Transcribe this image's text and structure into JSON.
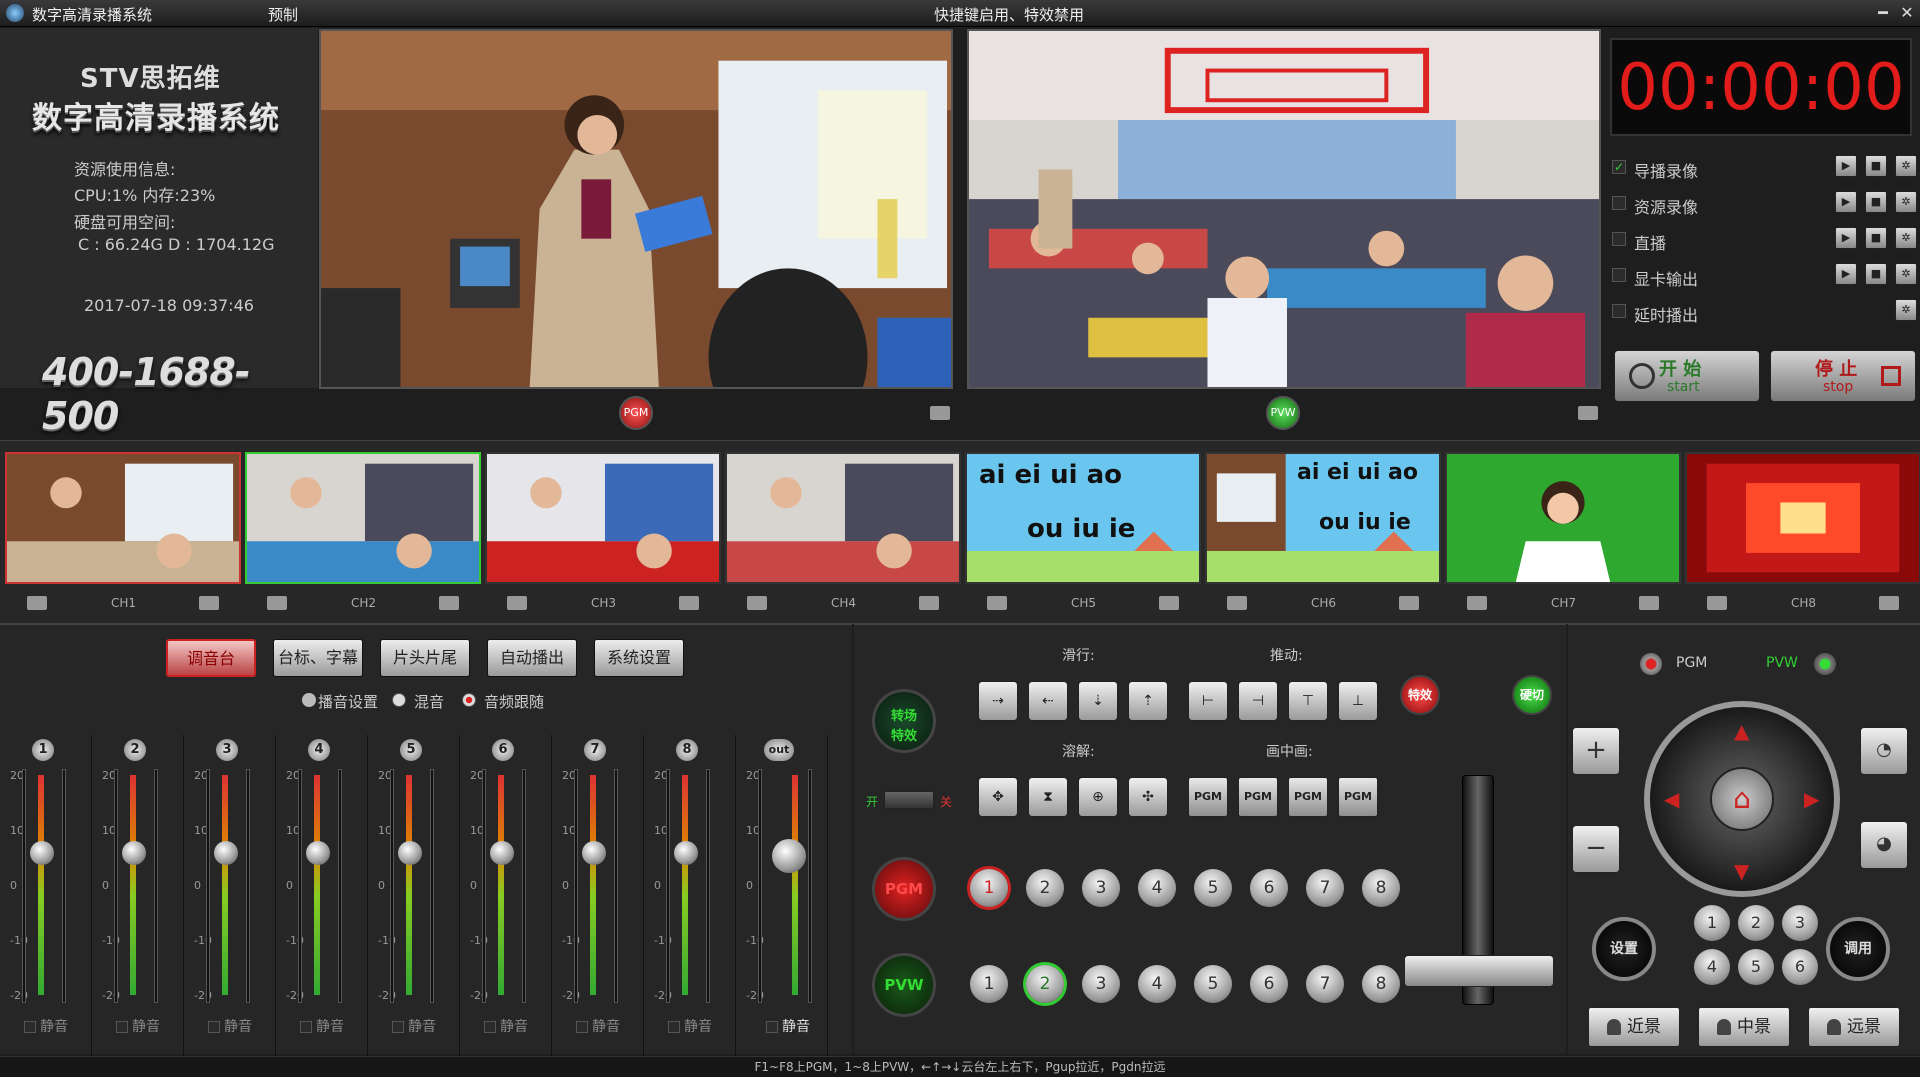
{
  "titlebar": {
    "app_title": "数字高清录播系统",
    "menu": "预制",
    "center_notice": "快捷键启用、特效禁用",
    "minimize": "━",
    "close": "✕"
  },
  "info": {
    "brand": "STV思拓维",
    "product": "数字高清录播系统",
    "resource_title": "资源使用信息:",
    "cpu_mem": "CPU:1% 内存:23%",
    "disk_title": "硬盘可用空间:",
    "disk_values": "C : 66.24G D : 1704.12G",
    "datetime": "2017-07-18 09:37:46",
    "phone": "400-1688-500"
  },
  "monitors": {
    "pgm_label": "PGM",
    "pvw_label": "PVW"
  },
  "record": {
    "timer": "00:00:00",
    "rows": [
      {
        "label": "导播录像",
        "checked": true,
        "controls": 3
      },
      {
        "label": "资源录像",
        "checked": false,
        "controls": 3
      },
      {
        "label": "直播",
        "checked": false,
        "controls": 3
      },
      {
        "label": "显卡输出",
        "checked": false,
        "controls": 3
      },
      {
        "label": "延时播出",
        "checked": false,
        "controls": 1
      }
    ],
    "start_cn": "开 始",
    "start_en": "start",
    "stop_cn": "停 止",
    "stop_en": "stop"
  },
  "channels": [
    "CH1",
    "CH2",
    "CH3",
    "CH4",
    "CH5",
    "CH6",
    "CH7",
    "CH8"
  ],
  "channel_texts": {
    "ch5_line1": "ai ei ui ao",
    "ch5_line2": "ou iu ie",
    "ch6_line1": "ai ei ui ao",
    "ch6_line2": "ou iu ie"
  },
  "audio": {
    "tabs": [
      "调音台",
      "台标、字幕",
      "片头片尾",
      "自动播出",
      "系统设置"
    ],
    "active_tab": 0,
    "play_settings": "播音设置",
    "mix": "混音",
    "follow": "音频跟随",
    "strips": [
      "1",
      "2",
      "3",
      "4",
      "5",
      "6",
      "7",
      "8",
      "out"
    ],
    "scale": [
      "20",
      "10",
      "0",
      "-10",
      "-20"
    ],
    "mute": "静音"
  },
  "switcher": {
    "slide_title": "滑行:",
    "push_title": "推动:",
    "dissolve_title": "溶解:",
    "pip_title": "画中画:",
    "effect_btn": "特效",
    "cut_btn": "硬切",
    "transition_label": "转场\n特效",
    "on": "开",
    "off": "关",
    "pip_btn": "PGM",
    "pgm_row_label": "PGM",
    "pvw_row_label": "PVW",
    "numbers": [
      "1",
      "2",
      "3",
      "4",
      "5",
      "6",
      "7",
      "8"
    ],
    "pgm_selected": 1,
    "pvw_selected": 2
  },
  "ptz": {
    "pgm": "PGM",
    "pvw": "PVW",
    "zoom_in": "+",
    "zoom_out": "−",
    "set": "设置",
    "call": "调用",
    "presets": [
      "1",
      "2",
      "3",
      "4",
      "5",
      "6"
    ],
    "shots": [
      "近景",
      "中景",
      "远景"
    ]
  },
  "status": "F1~F8上PGM，1~8上PVW，←↑→↓云台左上右下，Pgup拉近，Pgdn拉远"
}
